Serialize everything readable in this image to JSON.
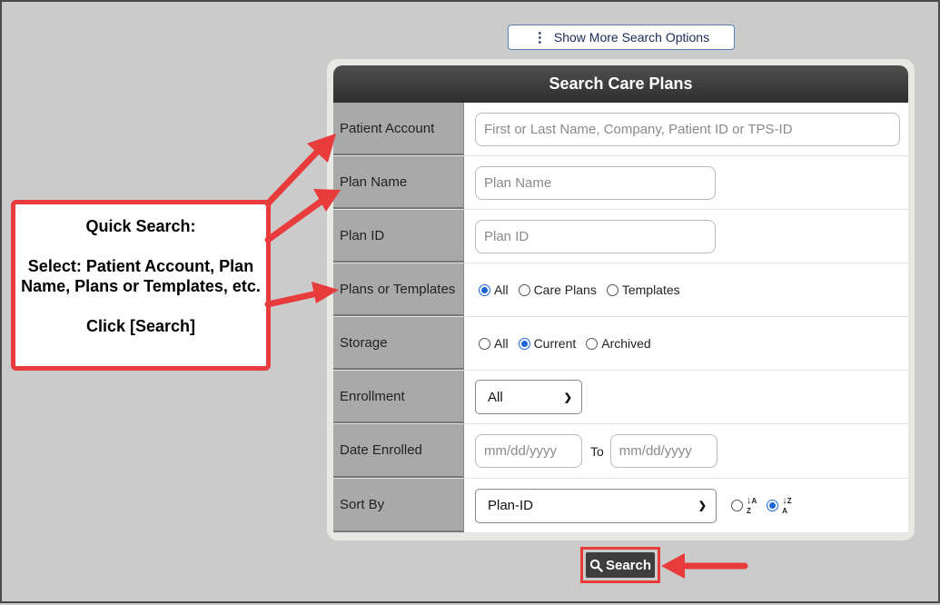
{
  "more_options": {
    "icon": "vertical-dots-icon",
    "label": "Show More Search Options"
  },
  "panel": {
    "title": "Search Care Plans",
    "rows": {
      "patient_account": {
        "label": "Patient Account",
        "placeholder": "First or Last Name, Company, Patient ID or TPS-ID"
      },
      "plan_name": {
        "label": "Plan Name",
        "placeholder": "Plan Name"
      },
      "plan_id": {
        "label": "Plan ID",
        "placeholder": "Plan ID"
      },
      "plans_or_templates": {
        "label": "Plans or Templates",
        "options": [
          "All",
          "Care Plans",
          "Templates"
        ],
        "selected": "All"
      },
      "storage": {
        "label": "Storage",
        "options": [
          "All",
          "Current",
          "Archived"
        ],
        "selected": "Current"
      },
      "enrollment": {
        "label": "Enrollment",
        "value": "All"
      },
      "date_enrolled": {
        "label": "Date Enrolled",
        "from_placeholder": "mm/dd/yyyy",
        "to_label": "To",
        "to_placeholder": "mm/dd/yyyy"
      },
      "sort_by": {
        "label": "Sort By",
        "value": "Plan-ID",
        "order_options": [
          "ascending-az-icon",
          "descending-za-icon"
        ],
        "order_selected": "descending-za-icon"
      }
    }
  },
  "search_button": {
    "icon": "magnifier-icon",
    "label": "Search"
  },
  "callout": {
    "title": "Quick Search:",
    "body": "Select: Patient Account, Plan Name, Plans or Templates, etc.",
    "action": "Click [Search]"
  },
  "colors": {
    "annotation_red": "#e83b3b",
    "header_dark": "#3a3a3a",
    "label_gray": "#a9a9a9",
    "radio_blue": "#1a66d6"
  }
}
